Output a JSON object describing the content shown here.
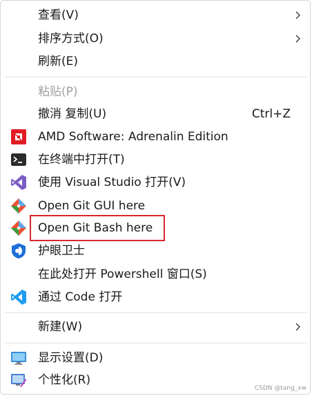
{
  "menu": {
    "items": [
      {
        "label": "查看(V)",
        "submenu": true
      },
      {
        "label": "排序方式(O)",
        "submenu": true
      },
      {
        "label": "刷新(E)"
      },
      {
        "label": "粘贴(P)",
        "disabled": true
      },
      {
        "label": "撤消 复制(U)",
        "shortcut": "Ctrl+Z"
      },
      {
        "label": "AMD Software: Adrenalin Edition",
        "icon": "amd-logo-icon"
      },
      {
        "label": "在终端中打开(T)",
        "icon": "terminal-icon"
      },
      {
        "label": "使用 Visual Studio 打开(V)",
        "icon": "visual-studio-icon"
      },
      {
        "label": "Open Git GUI here",
        "icon": "git-icon"
      },
      {
        "label": "Open Git Bash here",
        "icon": "git-icon",
        "highlighted": true
      },
      {
        "label": "护眼卫士",
        "icon": "eye-guard-shield-icon"
      },
      {
        "label": "在此处打开 Powershell 窗口(S)"
      },
      {
        "label": "通过 Code 打开",
        "icon": "vscode-icon"
      },
      {
        "label": "新建(W)",
        "submenu": true
      },
      {
        "label": "显示设置(D)",
        "icon": "display-monitor-icon"
      },
      {
        "label": "个性化(R)",
        "icon": "personalization-icon"
      }
    ]
  },
  "colors": {
    "highlight_border": "#d9262b",
    "amd_red": "#e21c24",
    "vs_purple": "#7b5cc4",
    "git_orange": "#f05133",
    "vscode_blue": "#1f9cf0"
  },
  "watermark": "CSDN @tang_xw"
}
